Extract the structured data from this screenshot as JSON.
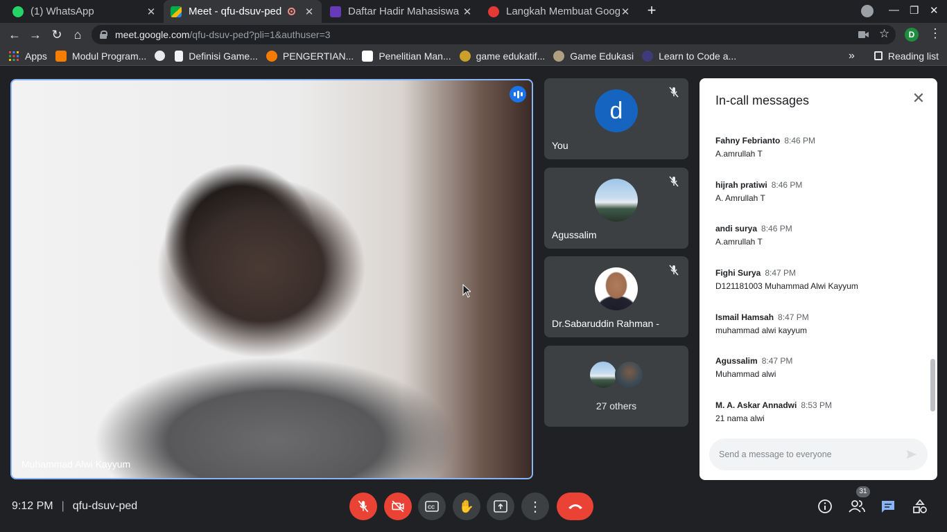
{
  "browser": {
    "tabs": [
      {
        "title": "(1) WhatsApp",
        "favicon_color": "#25d366"
      },
      {
        "title": "Meet - qfu-dsuv-ped",
        "favicon_color": "#00ac47"
      },
      {
        "title": "Daftar Hadir Mahasiswa K",
        "favicon_color": "#673ab7"
      },
      {
        "title": "Langkah Membuat Google",
        "favicon_color": "#e53935"
      }
    ],
    "url_host": "meet.google.com",
    "url_path": "/qfu-dsuv-ped?pli=1&authuser=3",
    "profile_initial": "D",
    "bookmarks": [
      {
        "label": "Apps",
        "icon": "apps-grid-icon"
      },
      {
        "label": "Modul Program...",
        "icon": "blogger-icon"
      },
      {
        "label": "",
        "icon": "globe-icon"
      },
      {
        "label": "Definisi Game...",
        "icon": "page-icon"
      },
      {
        "label": "PENGERTIAN...",
        "icon": "d-icon"
      },
      {
        "label": "Penelitian Man...",
        "icon": "k-icon"
      },
      {
        "label": "game edukatif...",
        "icon": "shield-icon"
      },
      {
        "label": "Game Edukasi",
        "icon": "eye-icon"
      },
      {
        "label": "Learn to Code a...",
        "icon": "codecademy-icon"
      }
    ],
    "more_bookmarks": "»",
    "reading_list": "Reading list"
  },
  "meet": {
    "main_participant": "Muhammad Alwi Kayyum",
    "participants": [
      {
        "name": "You",
        "avatar_initial": "d"
      },
      {
        "name": "Agussalim"
      },
      {
        "name": "Dr.Sabaruddin Rahman -"
      }
    ],
    "others_label": "27 others",
    "time": "9:12 PM",
    "meeting_code": "qfu-dsuv-ped",
    "people_count": "31"
  },
  "chat": {
    "title": "In-call messages",
    "messages": [
      {
        "sender": "Fahny Febrianto",
        "time": "8:46 PM",
        "text": "A.amrullah T"
      },
      {
        "sender": "hijrah pratiwi",
        "time": "8:46 PM",
        "text": "A. Amrullah T"
      },
      {
        "sender": "andi surya",
        "time": "8:46 PM",
        "text": "A.amrullah T"
      },
      {
        "sender": "Fighi Surya",
        "time": "8:47 PM",
        "text": "D121181003 Muhammad Alwi Kayyum"
      },
      {
        "sender": "Ismail Hamsah",
        "time": "8:47 PM",
        "text": "muhammad alwi kayyum"
      },
      {
        "sender": "Agussalim",
        "time": "8:47 PM",
        "text": "Muhammad alwi"
      },
      {
        "sender": "M. A. Askar Annadwi",
        "time": "8:53 PM",
        "text": "21 nama alwi"
      }
    ],
    "input_placeholder": "Send a message to everyone"
  },
  "colors": {
    "accent_blue": "#8ab4f8",
    "danger_red": "#ea4335",
    "meet_bg": "#202124",
    "tile_bg": "#3c4043"
  }
}
